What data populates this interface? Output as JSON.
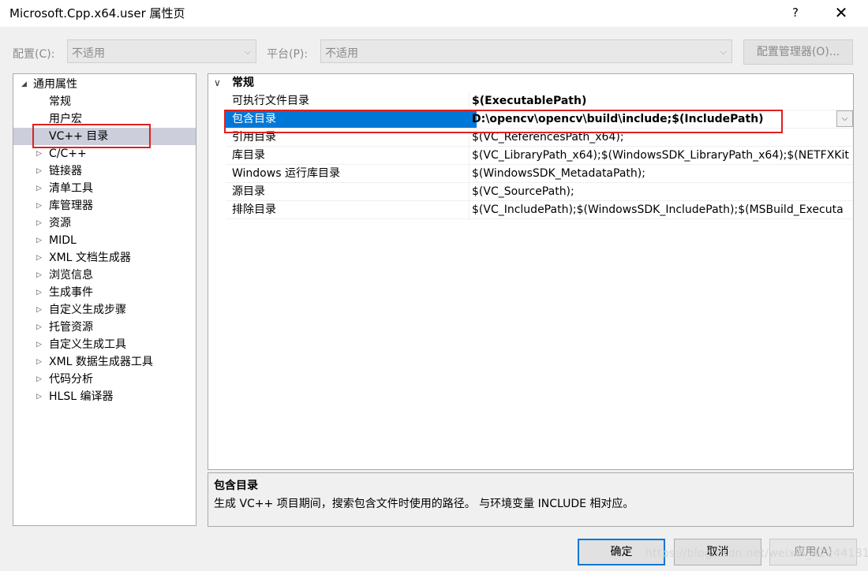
{
  "window": {
    "title": "Microsoft.Cpp.x64.user 属性页",
    "help": "?",
    "close": "✕"
  },
  "config_row": {
    "config_label": "配置(C):",
    "config_value": "不适用",
    "platform_label": "平台(P):",
    "platform_value": "不适用",
    "manager_button": "配置管理器(O)..."
  },
  "tree": {
    "root": "通用属性",
    "items": [
      "常规",
      "用户宏",
      "VC++ 目录",
      "C/C++",
      "链接器",
      "清单工具",
      "库管理器",
      "资源",
      "MIDL",
      "XML 文档生成器",
      "浏览信息",
      "生成事件",
      "自定义生成步骤",
      "托管资源",
      "自定义生成工具",
      "XML 数据生成器工具",
      "代码分析",
      "HLSL 编译器"
    ],
    "selected": "VC++ 目录"
  },
  "grid": {
    "category": "常规",
    "rows": [
      {
        "name": "可执行文件目录",
        "value": "$(ExecutablePath)"
      },
      {
        "name": "包含目录",
        "value": "D:\\opencv\\opencv\\build\\include;$(IncludePath)"
      },
      {
        "name": "引用目录",
        "value": "$(VC_ReferencesPath_x64);"
      },
      {
        "name": "库目录",
        "value": "$(VC_LibraryPath_x64);$(WindowsSDK_LibraryPath_x64);$(NETFXKit"
      },
      {
        "name": "Windows 运行库目录",
        "value": "$(WindowsSDK_MetadataPath);"
      },
      {
        "name": "源目录",
        "value": "$(VC_SourcePath);"
      },
      {
        "name": "排除目录",
        "value": "$(VC_IncludePath);$(WindowsSDK_IncludePath);$(MSBuild_Executa"
      }
    ]
  },
  "description": {
    "title": "包含目录",
    "text": "生成 VC++ 项目期间，搜索包含文件时使用的路径。 与环境变量 INCLUDE 相对应。"
  },
  "buttons": {
    "ok": "确定",
    "cancel": "取消",
    "apply": "应用(A)"
  },
  "watermark": "https://blog.csdn.net/weixin_42244181",
  "colors": {
    "selection": "#0078d7",
    "highlight_box": "#e02020",
    "tree_selection": "#cccedb"
  }
}
